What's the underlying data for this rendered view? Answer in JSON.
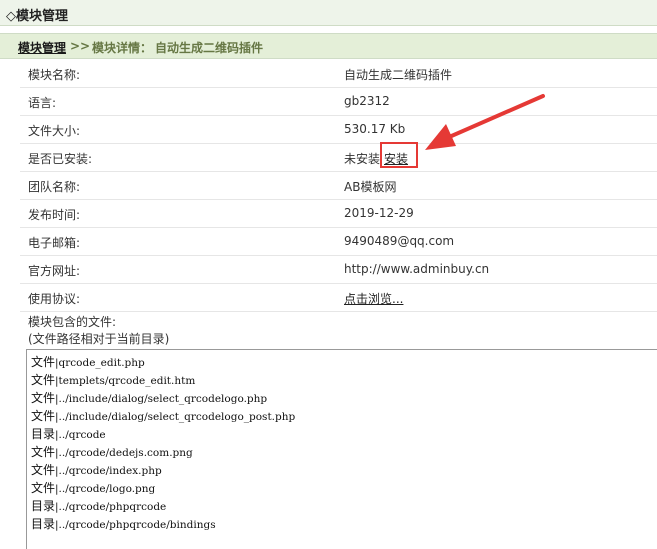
{
  "window": {
    "title": "◇模块管理"
  },
  "breadcrumb": {
    "root": "模块管理",
    "separator": ">>",
    "current_prefix": "模块详情：",
    "current_name": "自动生成二维码插件"
  },
  "details": [
    {
      "label": "模块名称:",
      "value": "自动生成二维码插件"
    },
    {
      "label": "语言:",
      "value": "gb2312"
    },
    {
      "label": "文件大小:",
      "value": "530.17 Kb"
    },
    {
      "label": "是否已安装:",
      "value": "未安装",
      "link": "安装"
    },
    {
      "label": "团队名称:",
      "value": "AB模板网"
    },
    {
      "label": "发布时间:",
      "value": "2019-12-29"
    },
    {
      "label": "电子邮箱:",
      "value": "9490489@qq.com"
    },
    {
      "label": "官方网址:",
      "value": "http://www.adminbuy.cn"
    },
    {
      "label": "使用协议:",
      "link": "点击浏览..."
    }
  ],
  "files": {
    "title_line1": "模块包含的文件:",
    "title_line2": "(文件路径相对于当前目录)",
    "items": [
      {
        "kind": "文件",
        "path": "|qrcode_edit.php"
      },
      {
        "kind": "文件",
        "path": "|templets/qrcode_edit.htm"
      },
      {
        "kind": "文件",
        "path": "|../include/dialog/select_qrcodelogo.php"
      },
      {
        "kind": "文件",
        "path": "|../include/dialog/select_qrcodelogo_post.php"
      },
      {
        "kind": "目录",
        "path": "|../qrcode"
      },
      {
        "kind": "文件",
        "path": "|../qrcode/dedejs.com.png"
      },
      {
        "kind": "文件",
        "path": "|../qrcode/index.php"
      },
      {
        "kind": "文件",
        "path": "|../qrcode/logo.png"
      },
      {
        "kind": "目录",
        "path": "|../qrcode/phpqrcode"
      },
      {
        "kind": "目录",
        "path": "|../qrcode/phpqrcode/bindings"
      }
    ]
  },
  "colors": {
    "annotation_red": "#e53935",
    "crumb_green": "#667744"
  }
}
